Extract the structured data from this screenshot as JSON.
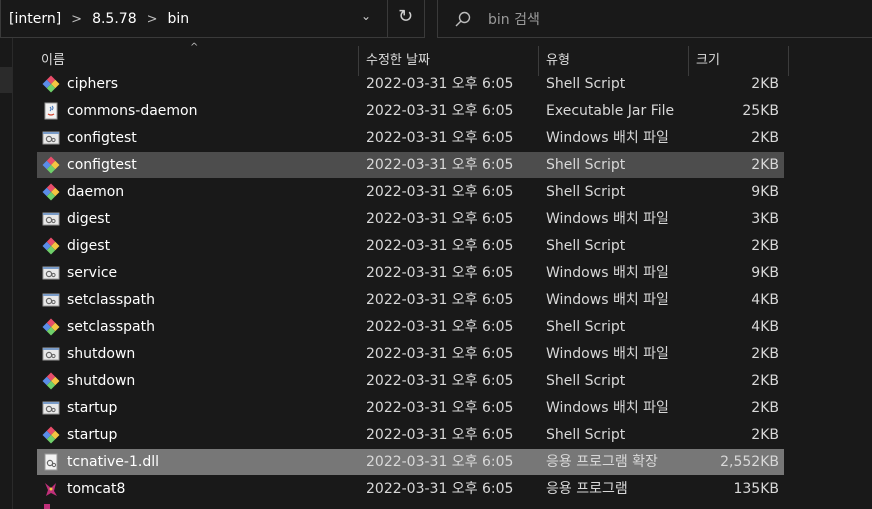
{
  "address_bar": {
    "crumbs": [
      "[intern]",
      "8.5.78",
      "bin"
    ],
    "separator": ">",
    "dropdown_glyph": "⌄",
    "refresh_glyph": "↻"
  },
  "search": {
    "placeholder": "bin 검색"
  },
  "columns": {
    "name": "이름",
    "date": "수정한 날짜",
    "type": "유형",
    "size": "크기"
  },
  "sort_indicator": "^",
  "files": [
    {
      "name": "ciphers",
      "date": "2022-03-31 오후 6:05",
      "type": "Shell Script",
      "size": "2KB",
      "icon": "shell-script-icon",
      "state": ""
    },
    {
      "name": "commons-daemon",
      "date": "2022-03-31 오후 6:05",
      "type": "Executable Jar File",
      "size": "25KB",
      "icon": "jar-file-icon",
      "state": ""
    },
    {
      "name": "configtest",
      "date": "2022-03-31 오후 6:05",
      "type": "Windows 배치 파일",
      "size": "2KB",
      "icon": "batch-file-icon",
      "state": ""
    },
    {
      "name": "configtest",
      "date": "2022-03-31 오후 6:05",
      "type": "Shell Script",
      "size": "2KB",
      "icon": "shell-script-icon",
      "state": "sel"
    },
    {
      "name": "daemon",
      "date": "2022-03-31 오후 6:05",
      "type": "Shell Script",
      "size": "9KB",
      "icon": "shell-script-icon",
      "state": ""
    },
    {
      "name": "digest",
      "date": "2022-03-31 오후 6:05",
      "type": "Windows 배치 파일",
      "size": "3KB",
      "icon": "batch-file-icon",
      "state": ""
    },
    {
      "name": "digest",
      "date": "2022-03-31 오후 6:05",
      "type": "Shell Script",
      "size": "2KB",
      "icon": "shell-script-icon",
      "state": ""
    },
    {
      "name": "service",
      "date": "2022-03-31 오후 6:05",
      "type": "Windows 배치 파일",
      "size": "9KB",
      "icon": "batch-file-icon",
      "state": ""
    },
    {
      "name": "setclasspath",
      "date": "2022-03-31 오후 6:05",
      "type": "Windows 배치 파일",
      "size": "4KB",
      "icon": "batch-file-icon",
      "state": ""
    },
    {
      "name": "setclasspath",
      "date": "2022-03-31 오후 6:05",
      "type": "Shell Script",
      "size": "4KB",
      "icon": "shell-script-icon",
      "state": ""
    },
    {
      "name": "shutdown",
      "date": "2022-03-31 오후 6:05",
      "type": "Windows 배치 파일",
      "size": "2KB",
      "icon": "batch-file-icon",
      "state": ""
    },
    {
      "name": "shutdown",
      "date": "2022-03-31 오후 6:05",
      "type": "Shell Script",
      "size": "2KB",
      "icon": "shell-script-icon",
      "state": ""
    },
    {
      "name": "startup",
      "date": "2022-03-31 오후 6:05",
      "type": "Windows 배치 파일",
      "size": "2KB",
      "icon": "batch-file-icon",
      "state": ""
    },
    {
      "name": "startup",
      "date": "2022-03-31 오후 6:05",
      "type": "Shell Script",
      "size": "2KB",
      "icon": "shell-script-icon",
      "state": ""
    },
    {
      "name": "tcnative-1.dll",
      "date": "2022-03-31 오후 6:05",
      "type": "응용 프로그램 확장",
      "size": "2,552KB",
      "icon": "dll-file-icon",
      "state": "sel2"
    },
    {
      "name": "tomcat8",
      "date": "2022-03-31 오후 6:05",
      "type": "응용 프로그램",
      "size": "135KB",
      "icon": "tomcat-app-icon",
      "state": ""
    }
  ],
  "colors": {
    "background": "#191919",
    "selected_row": "#4d4d4d",
    "highlighted_row": "#777777"
  }
}
